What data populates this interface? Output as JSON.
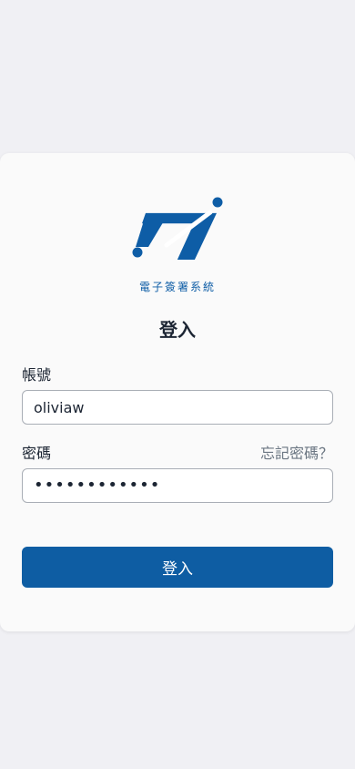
{
  "logo": {
    "caption": "電子簽署系統",
    "brand_color": "#0e5da6"
  },
  "login": {
    "title": "登入",
    "account_label": "帳號",
    "account_value": "oliviaw",
    "password_label": "密碼",
    "forgot_label": "忘記密碼？",
    "password_value": "••••••••••••",
    "submit_label": "登入"
  }
}
